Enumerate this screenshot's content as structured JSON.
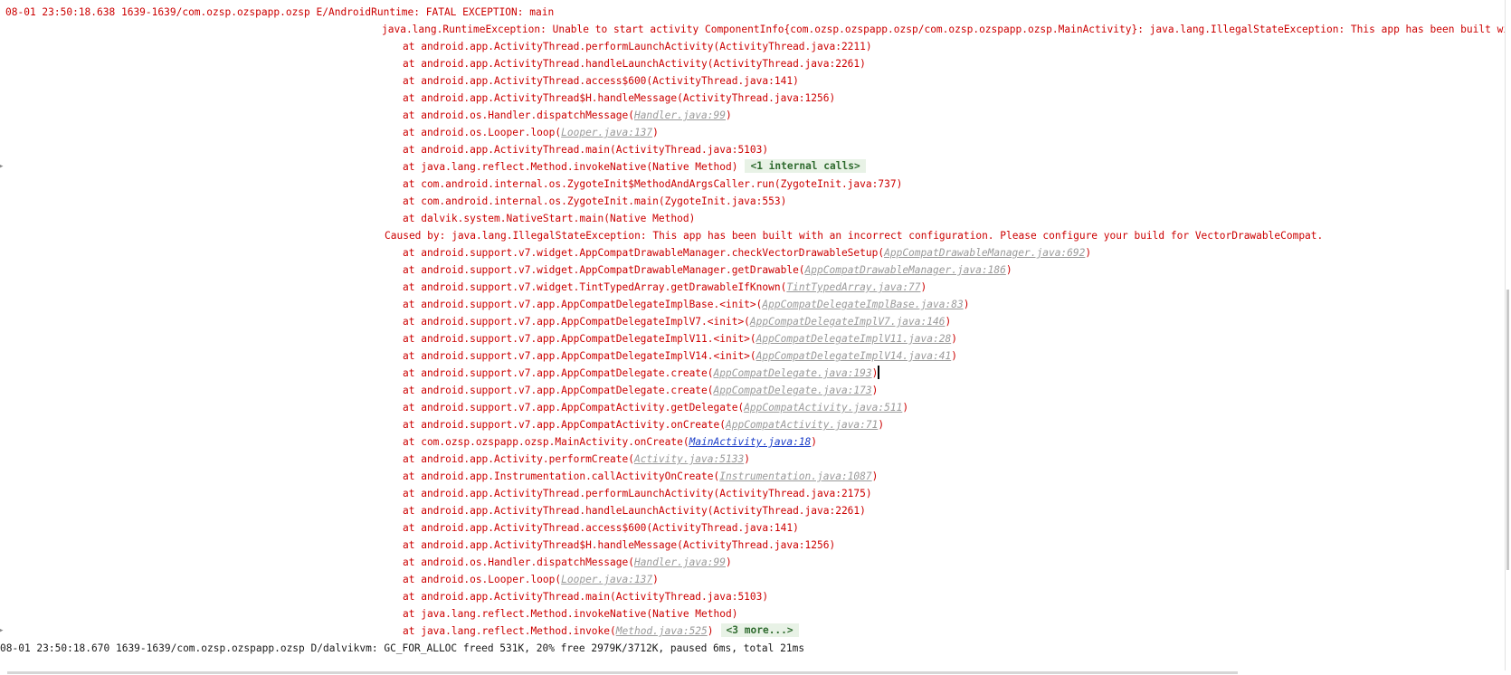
{
  "log": {
    "lines": [
      {
        "kind": "header",
        "text": "08-01 23:50:18.638 1639-1639/com.ozsp.ozspapp.ozsp E/AndroidRuntime: FATAL EXCEPTION: main"
      },
      {
        "kind": "exc",
        "text": "java.lang.RuntimeException: Unable to start activity ComponentInfo{com.ozsp.ozspapp.ozsp/com.ozsp.ozspapp.ozsp.MainActivity}: java.lang.IllegalStateException: This app has been built with an incorrect configu"
      },
      {
        "kind": "frame",
        "text": "at android.app.ActivityThread.performLaunchActivity(ActivityThread.java:2211)"
      },
      {
        "kind": "frame",
        "text": "at android.app.ActivityThread.handleLaunchActivity(ActivityThread.java:2261)"
      },
      {
        "kind": "frame",
        "text": "at android.app.ActivityThread.access$600(ActivityThread.java:141)"
      },
      {
        "kind": "frame",
        "text": "at android.app.ActivityThread$H.handleMessage(ActivityThread.java:1256)"
      },
      {
        "kind": "frame",
        "text": "at android.os.Handler.dispatchMessage(",
        "link": "Handler.java:99",
        "after": ")"
      },
      {
        "kind": "frame",
        "text": "at android.os.Looper.loop(",
        "link": "Looper.java:137",
        "after": ")"
      },
      {
        "kind": "frame",
        "text": "at android.app.ActivityThread.main(ActivityThread.java:5103)"
      },
      {
        "kind": "frame",
        "text": "at java.lang.reflect.Method.invokeNative(Native Method)",
        "fold": "<1 internal calls>",
        "gutter": "▸"
      },
      {
        "kind": "frame",
        "text": "at com.android.internal.os.ZygoteInit$MethodAndArgsCaller.run(ZygoteInit.java:737)"
      },
      {
        "kind": "frame",
        "text": "at com.android.internal.os.ZygoteInit.main(ZygoteInit.java:553)"
      },
      {
        "kind": "frame",
        "text": "at dalvik.system.NativeStart.main(Native Method)"
      },
      {
        "kind": "caused",
        "text": "Caused by: java.lang.IllegalStateException: This app has been built with an incorrect configuration. Please configure your build for VectorDrawableCompat."
      },
      {
        "kind": "frame",
        "text": "at android.support.v7.widget.AppCompatDrawableManager.checkVectorDrawableSetup(",
        "link": "AppCompatDrawableManager.java:692",
        "after": ")"
      },
      {
        "kind": "frame",
        "text": "at android.support.v7.widget.AppCompatDrawableManager.getDrawable(",
        "link": "AppCompatDrawableManager.java:186",
        "after": ")"
      },
      {
        "kind": "frame",
        "text": "at android.support.v7.widget.TintTypedArray.getDrawableIfKnown(",
        "link": "TintTypedArray.java:77",
        "after": ")"
      },
      {
        "kind": "frame",
        "text": "at android.support.v7.app.AppCompatDelegateImplBase.<init>(",
        "link": "AppCompatDelegateImplBase.java:83",
        "after": ")"
      },
      {
        "kind": "frame",
        "text": "at android.support.v7.app.AppCompatDelegateImplV7.<init>(",
        "link": "AppCompatDelegateImplV7.java:146",
        "after": ")"
      },
      {
        "kind": "frame",
        "text": "at android.support.v7.app.AppCompatDelegateImplV11.<init>(",
        "link": "AppCompatDelegateImplV11.java:28",
        "after": ")"
      },
      {
        "kind": "frame",
        "text": "at android.support.v7.app.AppCompatDelegateImplV14.<init>(",
        "link": "AppCompatDelegateImplV14.java:41",
        "after": ")"
      },
      {
        "kind": "frame",
        "text": "at android.support.v7.app.AppCompatDelegate.create(",
        "link": "AppCompatDelegate.java:193",
        "after": ")",
        "caret": true
      },
      {
        "kind": "frame",
        "text": "at android.support.v7.app.AppCompatDelegate.create(",
        "link": "AppCompatDelegate.java:173",
        "after": ")"
      },
      {
        "kind": "frame",
        "text": "at android.support.v7.app.AppCompatActivity.getDelegate(",
        "link": "AppCompatActivity.java:511",
        "after": ")"
      },
      {
        "kind": "frame",
        "text": "at android.support.v7.app.AppCompatActivity.onCreate(",
        "link": "AppCompatActivity.java:71",
        "after": ")"
      },
      {
        "kind": "frame",
        "text": "at com.ozsp.ozspapp.ozsp.MainActivity.onCreate(",
        "link": "MainActivity.java:18",
        "after": ")",
        "app": true
      },
      {
        "kind": "frame",
        "text": "at android.app.Activity.performCreate(",
        "link": "Activity.java:5133",
        "after": ")"
      },
      {
        "kind": "frame",
        "text": "at android.app.Instrumentation.callActivityOnCreate(",
        "link": "Instrumentation.java:1087",
        "after": ")"
      },
      {
        "kind": "frame",
        "text": "at android.app.ActivityThread.performLaunchActivity(ActivityThread.java:2175)"
      },
      {
        "kind": "frame",
        "text": "at android.app.ActivityThread.handleLaunchActivity(ActivityThread.java:2261)"
      },
      {
        "kind": "frame",
        "text": "at android.app.ActivityThread.access$600(ActivityThread.java:141)"
      },
      {
        "kind": "frame",
        "text": "at android.app.ActivityThread$H.handleMessage(ActivityThread.java:1256)"
      },
      {
        "kind": "frame",
        "text": "at android.os.Handler.dispatchMessage(",
        "link": "Handler.java:99",
        "after": ")"
      },
      {
        "kind": "frame",
        "text": "at android.os.Looper.loop(",
        "link": "Looper.java:137",
        "after": ")"
      },
      {
        "kind": "frame",
        "text": "at android.app.ActivityThread.main(ActivityThread.java:5103)"
      },
      {
        "kind": "frame",
        "text": "at java.lang.reflect.Method.invokeNative(Native Method)"
      },
      {
        "kind": "frame",
        "text": "at java.lang.reflect.Method.invoke(",
        "link": "Method.java:525",
        "after": ")",
        "fold": "<3 more...>",
        "gutter": "▸"
      },
      {
        "kind": "debug",
        "text": "08-01 23:50:18.670 1639-1639/com.ozsp.ozspapp.ozsp D/dalvikvm: GC_FOR_ALLOC freed 531K, 20% free 2979K/3712K, paused 6ms, total 21ms"
      }
    ]
  },
  "colors": {
    "error_text": "#cc0000",
    "debug_text": "#1a1a1a",
    "link_text": "#9a9a9a",
    "app_link_text": "#1a3cc8",
    "fold_chip_bg": "#e8f2e6",
    "fold_chip_text": "#2f6b2f"
  }
}
